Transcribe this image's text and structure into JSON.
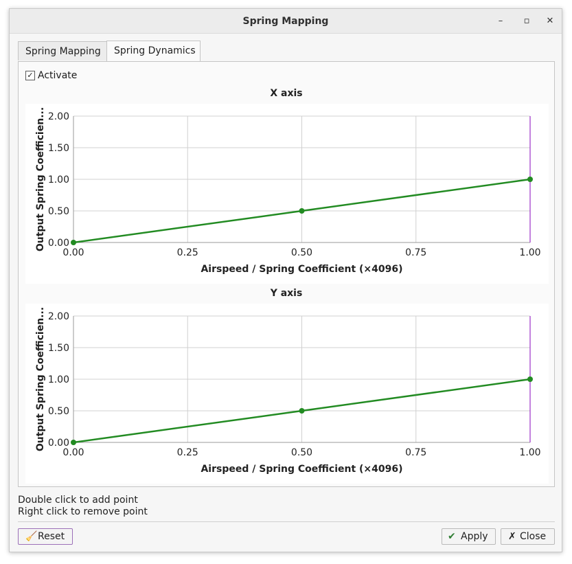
{
  "window": {
    "title": "Spring Mapping"
  },
  "title_buttons": {
    "minimize": "–",
    "maximize": "▫",
    "close": "✕"
  },
  "tabs": [
    {
      "label": "Spring Mapping",
      "active": false
    },
    {
      "label": "Spring Dynamics",
      "active": true
    }
  ],
  "activate": {
    "label": "Activate",
    "checked": true,
    "mark": "✓"
  },
  "colors": {
    "curve": "#228b22",
    "limit_line": "#9b30c8",
    "grid": "#d0d0d0"
  },
  "chart_data": [
    {
      "type": "line",
      "title": "X axis",
      "xlabel": "Airspeed / Spring Coefficient (×4096)",
      "ylabel": "Output Spring Coefficien...",
      "xlim": [
        0,
        1
      ],
      "ylim": [
        0,
        2
      ],
      "x_ticks": [
        "0.00",
        "0.25",
        "0.50",
        "0.75",
        "1.00"
      ],
      "y_ticks": [
        "0.00",
        "0.50",
        "1.00",
        "1.50",
        "2.00"
      ],
      "grid": true,
      "points": [
        [
          0.0,
          0.0
        ],
        [
          0.5,
          0.5
        ],
        [
          1.0,
          1.0
        ]
      ],
      "vertical_marker_x": 1.0
    },
    {
      "type": "line",
      "title": "Y axis",
      "xlabel": "Airspeed / Spring Coefficient (×4096)",
      "ylabel": "Output Spring Coefficien...",
      "xlim": [
        0,
        1
      ],
      "ylim": [
        0,
        2
      ],
      "x_ticks": [
        "0.00",
        "0.25",
        "0.50",
        "0.75",
        "1.00"
      ],
      "y_ticks": [
        "0.00",
        "0.50",
        "1.00",
        "1.50",
        "2.00"
      ],
      "grid": true,
      "points": [
        [
          0.0,
          0.0
        ],
        [
          0.5,
          0.5
        ],
        [
          1.0,
          1.0
        ]
      ],
      "vertical_marker_x": 1.0
    }
  ],
  "hints": [
    "Double click to add point",
    "Right click to remove point"
  ],
  "buttons": {
    "reset": {
      "label": "Reset",
      "icon": "broom-icon"
    },
    "apply": {
      "label": "Apply",
      "icon": "checkmark-icon"
    },
    "close": {
      "label": "Close",
      "icon": "close-icon"
    }
  }
}
